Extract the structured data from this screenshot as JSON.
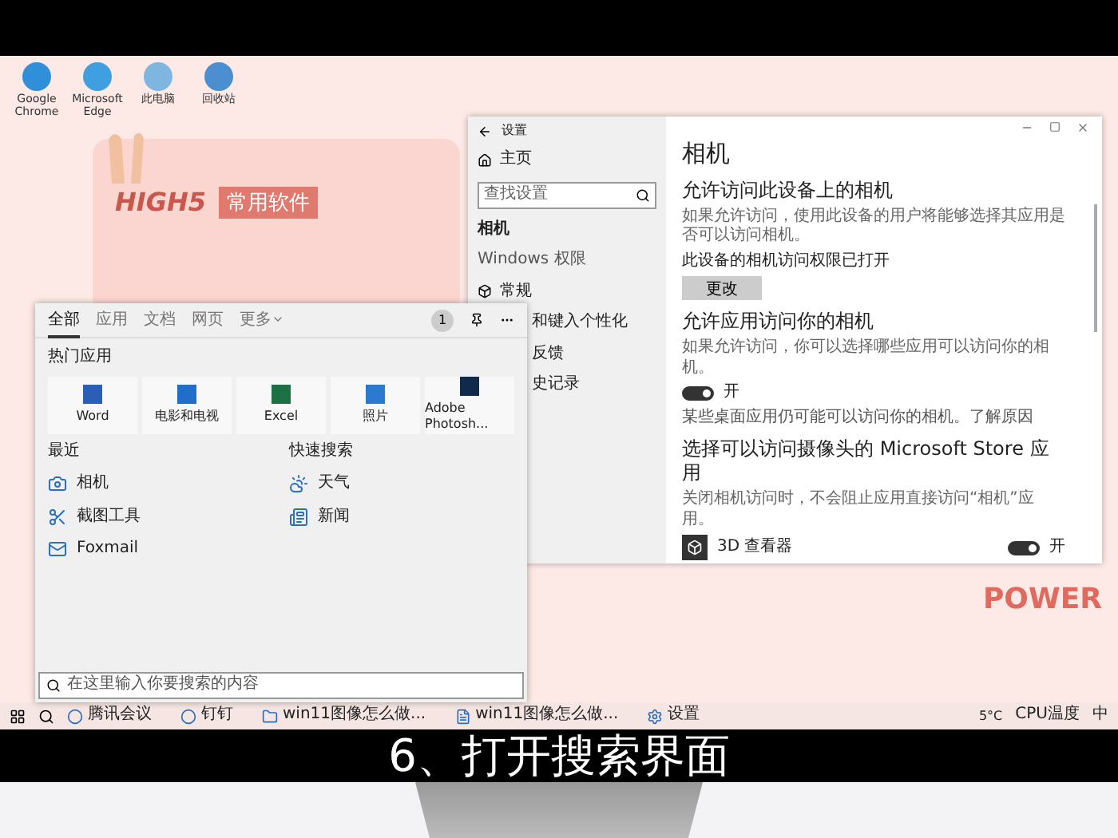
{
  "desktop": {
    "icons": [
      {
        "label": "Google Chrome",
        "color": "#2f8fd8"
      },
      {
        "label": "Microsoft Edge",
        "color": "#3f9fe0"
      },
      {
        "label": "此电脑",
        "color": "#7fb6e0"
      },
      {
        "label": "回收站",
        "color": "#4b8fd0"
      }
    ],
    "card": {
      "badge": "HIGH5",
      "title": "常用软件"
    },
    "sticker": "POWER"
  },
  "settings_window": {
    "title": "设置",
    "nav": {
      "home": "主页",
      "search_placeholder": "查找设置",
      "current": "相机",
      "group": "Windows 权限",
      "items": [
        {
          "label": "常规"
        },
        {
          "label": "和键入个性化"
        },
        {
          "label": "反馈"
        },
        {
          "label": "史记录"
        }
      ]
    },
    "page": {
      "title": "相机",
      "sections": [
        {
          "title": "允许访问此设备上的相机",
          "text": "如果允许访问，使用此设备的用户将能够选择其应用是否可以访问相机。",
          "status": "此设备的相机访问权限已打开",
          "button": "更改"
        },
        {
          "title": "允许应用访问你的相机",
          "text": "如果允许访问，你可以选择哪些应用可以访问你的相机。",
          "toggle": {
            "on": true,
            "label": "开"
          },
          "note": "某些桌面应用仍可能可以访问你的相机。了解原因"
        },
        {
          "title": "选择可以访问摄像头的 Microsoft Store 应用",
          "text": "关闭相机访问时，不会阻止应用直接访问“相机”应用。",
          "apps": [
            {
              "name": "3D 查看器",
              "on": true,
              "state_label": "开"
            }
          ]
        }
      ]
    }
  },
  "search_panel": {
    "tabs": [
      {
        "label": "全部",
        "selected": true
      },
      {
        "label": "应用",
        "selected": false
      },
      {
        "label": "文档",
        "selected": false
      },
      {
        "label": "网页",
        "selected": false
      },
      {
        "label": "更多",
        "selected": false,
        "dropdown": true
      }
    ],
    "badge": "1",
    "top_apps": {
      "title": "热门应用",
      "items": [
        {
          "label": "Word",
          "color": "#2b5fb4"
        },
        {
          "label": "电影和电视",
          "color": "#1f6fc8"
        },
        {
          "label": "Excel",
          "color": "#1d7044"
        },
        {
          "label": "照片",
          "color": "#2a7bd0"
        },
        {
          "label": "Adobe Photosh...",
          "color": "#0f2a4a"
        }
      ]
    },
    "recent": {
      "title": "最近",
      "items": [
        {
          "label": "相机",
          "kind": "camera"
        },
        {
          "label": "截图工具",
          "kind": "scissors"
        },
        {
          "label": "Foxmail",
          "kind": "mail"
        }
      ]
    },
    "quick": {
      "title": "快速搜索",
      "items": [
        {
          "label": "天气",
          "kind": "weather"
        },
        {
          "label": "新闻",
          "kind": "news"
        }
      ]
    },
    "search_placeholder": "在这里输入你要搜索的内容"
  },
  "taskbar": {
    "items": [
      {
        "label": "腾讯会议",
        "kind": "circle"
      },
      {
        "label": "钉钉",
        "kind": "circle"
      },
      {
        "label": "win11图像怎么做...",
        "kind": "folder"
      },
      {
        "label": "win11图像怎么做...",
        "kind": "doc"
      },
      {
        "label": "设置",
        "kind": "gear"
      }
    ],
    "weather": "5°C",
    "weather_note": "CPU温度",
    "ime": "中"
  },
  "subtitle": "6、打开搜索界面"
}
